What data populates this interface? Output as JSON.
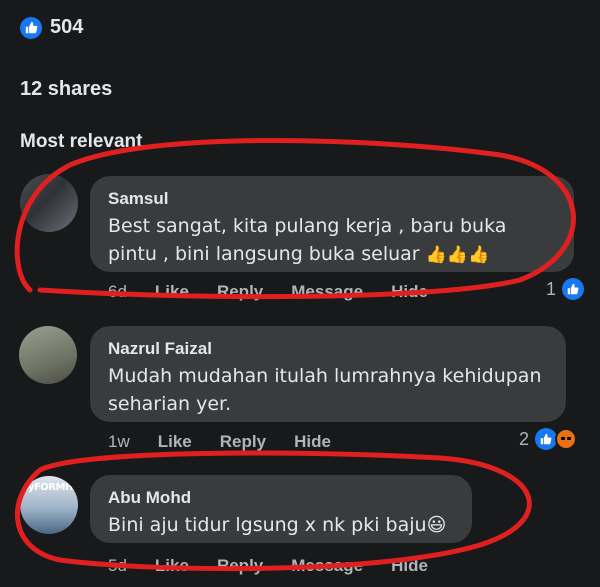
{
  "post": {
    "reaction_count": "504",
    "shares": "12 shares",
    "filter_label": "Most relevant"
  },
  "comments": [
    {
      "author": "Samsul",
      "text": "Best sangat, kita pulang kerja , baru buka pintu , bini langsung buka seluar",
      "emoji": "👍👍👍",
      "time": "6d",
      "actions": [
        "Like",
        "Reply",
        "Message",
        "Hide"
      ],
      "reaction_count": "1",
      "reactions": [
        "like-icon"
      ]
    },
    {
      "author": "Nazrul Faizal",
      "text": "Mudah mudahan itulah lumrahnya kehidupan seharian yer.",
      "emoji": "",
      "time": "1w",
      "actions": [
        "Like",
        "Reply",
        "Hide"
      ],
      "reaction_count": "2",
      "reactions": [
        "like-icon",
        "angry-icon"
      ]
    },
    {
      "author": "Abu Mohd",
      "text": "Bini aju tidur lgsung x nk pki baju",
      "emoji": "😃",
      "avatar_text": "ayFORMH3",
      "time": "5d",
      "actions": [
        "Like",
        "Reply",
        "Message",
        "Hide"
      ],
      "reaction_count": "",
      "reactions": []
    }
  ],
  "colors": {
    "background": "#18191a",
    "bubble": "#3a3b3c",
    "like_blue": "#1877f2",
    "annotation_red": "#e02020"
  }
}
